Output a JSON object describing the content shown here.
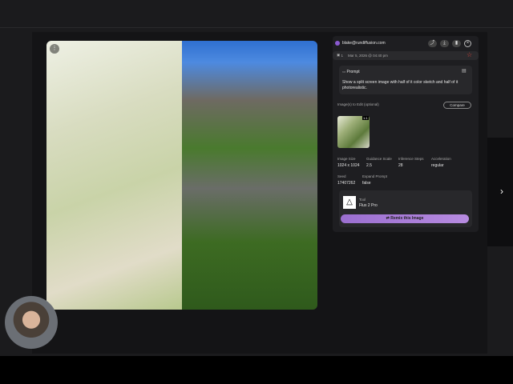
{
  "header": {
    "user_email": "blake@rundiffusion.com",
    "count": "1",
    "date": "Mar 5, 2026 @ 04:40 pm"
  },
  "prompt": {
    "title": "Prompt",
    "text": "Show a split screen image with half of it color sketch and half of it photorealistic."
  },
  "images_to_edit": {
    "label": "Image(s) to Edit (optional)",
    "compare_label": "Compare",
    "thumb_badge": "1:1"
  },
  "params": [
    {
      "label": "Image Size",
      "value": "1024 x 1024"
    },
    {
      "label": "Guidance Scale",
      "value": "2.5"
    },
    {
      "label": "Inference Steps",
      "value": "28"
    },
    {
      "label": "Acceleration",
      "value": "regular"
    },
    {
      "label": "Seed",
      "value": "17407262"
    },
    {
      "label": "Expand Prompt",
      "value": "false"
    }
  ],
  "tool": {
    "label": "Tool",
    "name": "Flux 2 Pro"
  },
  "remix_label": "Remix this Image",
  "accent": "#a97ed8"
}
